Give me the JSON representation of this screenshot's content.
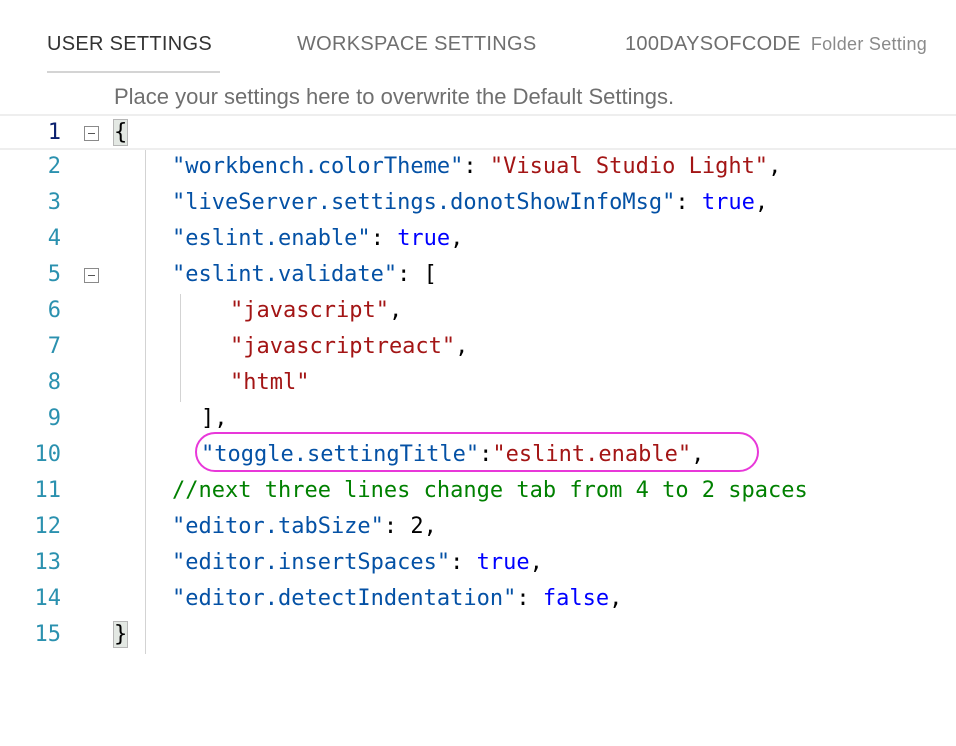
{
  "tabs": {
    "user": "USER SETTINGS",
    "workspace": "WORKSPACE SETTINGS",
    "folder": "100DAYSOFCODE",
    "folder_sub": "Folder Setting"
  },
  "hint": "Place your settings here to overwrite the Default Settings.",
  "lines": [
    {
      "n": "1",
      "parts": [
        {
          "t": "{",
          "c": "p"
        }
      ]
    },
    {
      "n": "2",
      "parts": [
        {
          "t": "\"workbench.colorTheme\"",
          "c": "k"
        },
        {
          "t": ": ",
          "c": "p"
        },
        {
          "t": "\"Visual Studio Light\"",
          "c": "s"
        },
        {
          "t": ",",
          "c": "p"
        }
      ]
    },
    {
      "n": "3",
      "parts": [
        {
          "t": "\"liveServer.settings.donotShowInfoMsg\"",
          "c": "k"
        },
        {
          "t": ": ",
          "c": "p"
        },
        {
          "t": "true",
          "c": "b"
        },
        {
          "t": ",",
          "c": "p"
        }
      ]
    },
    {
      "n": "4",
      "parts": [
        {
          "t": "\"eslint.enable\"",
          "c": "k"
        },
        {
          "t": ": ",
          "c": "p"
        },
        {
          "t": "true",
          "c": "b"
        },
        {
          "t": ",",
          "c": "p"
        }
      ]
    },
    {
      "n": "5",
      "parts": [
        {
          "t": "\"eslint.validate\"",
          "c": "k"
        },
        {
          "t": ": [",
          "c": "p"
        }
      ]
    },
    {
      "n": "6",
      "parts": [
        {
          "t": "\"javascript\"",
          "c": "s"
        },
        {
          "t": ",",
          "c": "p"
        }
      ]
    },
    {
      "n": "7",
      "parts": [
        {
          "t": "\"javascriptreact\"",
          "c": "s"
        },
        {
          "t": ",",
          "c": "p"
        }
      ]
    },
    {
      "n": "8",
      "parts": [
        {
          "t": "\"html\"",
          "c": "s"
        }
      ]
    },
    {
      "n": "9",
      "parts": [
        {
          "t": "],",
          "c": "p"
        }
      ]
    },
    {
      "n": "10",
      "parts": [
        {
          "t": "\"toggle.settingTitle\"",
          "c": "k"
        },
        {
          "t": ":",
          "c": "p"
        },
        {
          "t": "\"eslint.enable\"",
          "c": "s"
        },
        {
          "t": ",",
          "c": "p"
        }
      ]
    },
    {
      "n": "11",
      "parts": [
        {
          "t": "//next three lines change tab from 4 to 2 spaces",
          "c": "c"
        }
      ]
    },
    {
      "n": "12",
      "parts": [
        {
          "t": "\"editor.tabSize\"",
          "c": "k"
        },
        {
          "t": ": ",
          "c": "p"
        },
        {
          "t": "2",
          "c": "p"
        },
        {
          "t": ",",
          "c": "p"
        }
      ]
    },
    {
      "n": "13",
      "parts": [
        {
          "t": "\"editor.insertSpaces\"",
          "c": "k"
        },
        {
          "t": ": ",
          "c": "p"
        },
        {
          "t": "true",
          "c": "b"
        },
        {
          "t": ",",
          "c": "p"
        }
      ]
    },
    {
      "n": "14",
      "parts": [
        {
          "t": "\"editor.detectIndentation\"",
          "c": "k"
        },
        {
          "t": ": ",
          "c": "p"
        },
        {
          "t": "false",
          "c": "b"
        },
        {
          "t": ",",
          "c": "p"
        }
      ]
    },
    {
      "n": "15",
      "parts": [
        {
          "t": "}",
          "c": "p"
        }
      ]
    }
  ],
  "colors": {
    "key": "#0451a5",
    "string": "#a31515",
    "boolean": "#0000ff",
    "comment": "#008000",
    "line_number": "#2b91af",
    "annotation": "#e838d9"
  }
}
